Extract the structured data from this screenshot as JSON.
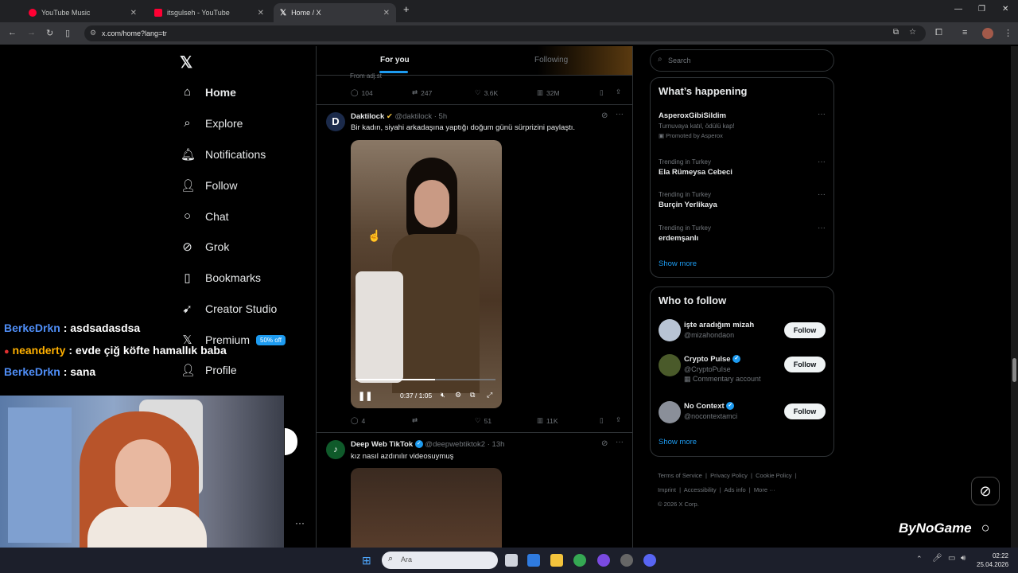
{
  "browser": {
    "tabs": [
      {
        "title": "YouTube Music",
        "color": "#ff0033"
      },
      {
        "title": "itsgulseh - YouTube",
        "color": "#ff0033"
      },
      {
        "title": "Home / X",
        "color": "#ffffff"
      }
    ],
    "url": "x.com/home?lang=tr"
  },
  "x_nav": {
    "items": [
      {
        "label": "Home",
        "icon": "home-icon"
      },
      {
        "label": "Explore",
        "icon": "search-icon"
      },
      {
        "label": "Notifications",
        "icon": "bell-icon"
      },
      {
        "label": "Follow",
        "icon": "person-add-icon"
      },
      {
        "label": "Chat",
        "icon": "chat-icon"
      },
      {
        "label": "Grok",
        "icon": "grok-icon"
      },
      {
        "label": "Bookmarks",
        "icon": "bookmark-icon"
      },
      {
        "label": "Creator Studio",
        "icon": "rocket-icon"
      },
      {
        "label": "Premium",
        "icon": "x-icon"
      },
      {
        "label": "Profile",
        "icon": "person-icon"
      }
    ],
    "premium_badge": "50% off"
  },
  "timeline": {
    "tabs": [
      "For you",
      "Following"
    ],
    "prev_post": {
      "from": "From adj.st",
      "replies": "104",
      "reposts": "247",
      "likes": "3.6K",
      "views": "32M"
    },
    "post1": {
      "name": "Daktilock",
      "handle": "@daktilock",
      "time": "· 5h",
      "text": "Bir kadın, siyahi arkadaşına yaptığı doğum günü sürprizini paylaştı.",
      "video_time": "0:37 / 1:05",
      "video_progress": 0.57,
      "replies": "4",
      "reposts": "",
      "likes": "51",
      "views": "11K"
    },
    "post2": {
      "name": "Deep Web TikTok",
      "handle": "@deepwebtiktok2",
      "time": "· 13h",
      "text": "kız nasıl azdınılır videosuymuş"
    }
  },
  "right": {
    "search_placeholder": "Search",
    "happening_title": "What’s happening",
    "trends": [
      {
        "top": "AsperoxGibiSildim",
        "mid": "Turnuvaya katıl, ödülü kap!",
        "bottom": "Promoted by Asperox",
        "promoted": true
      },
      {
        "top": "Trending in Turkey",
        "name": "Ela Rümeysa Cebeci"
      },
      {
        "top": "Trending in Turkey",
        "name": "Burçin Yerlikaya"
      },
      {
        "top": "Trending in Turkey",
        "name": "erdemşanlı"
      }
    ],
    "show_more": "Show more",
    "wtf_title": "Who to follow",
    "wtf": [
      {
        "name": "işte aradığım mizah",
        "handle": "@mizahondaon",
        "verified": false,
        "extra": ""
      },
      {
        "name": "Crypto Pulse",
        "handle": "@CryptoPuIse",
        "verified": true,
        "extra": "Commentary account"
      },
      {
        "name": "No Context",
        "handle": "@nocontextamci",
        "verified": true,
        "extra": ""
      }
    ],
    "follow_label": "Follow",
    "footer": [
      "Terms of Service",
      "Privacy Policy",
      "Cookie Policy",
      "Imprint",
      "Accessibility",
      "Ads info",
      "More ···",
      "© 2026 X Corp."
    ]
  },
  "chat": [
    {
      "user": "BerkeDrkn",
      "msg": ": asdsadasdsa",
      "color": "#4f8ef7"
    },
    {
      "user": "neanderty",
      "msg": ": evde çiğ köfte hamallık baba",
      "color": "#ffb000"
    },
    {
      "user": "BerkeDrkn",
      "msg": ": sana",
      "color": "#4f8ef7"
    }
  ],
  "watermark": "ByNoGame",
  "taskbar": {
    "search_placeholder": "Ara",
    "time": "02:22",
    "date": "25.04.2026"
  }
}
